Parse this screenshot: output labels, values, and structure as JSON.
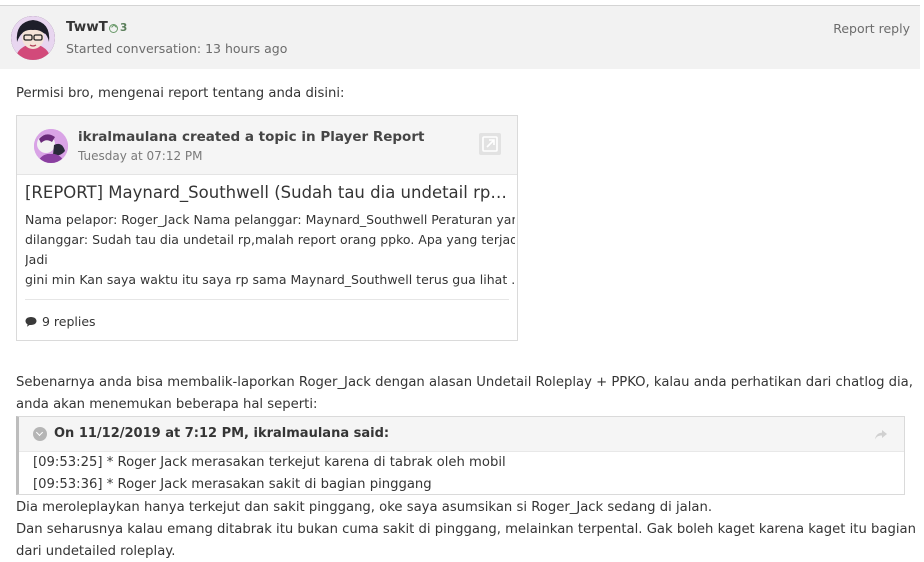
{
  "post": {
    "author": "TwwT",
    "reputation": "3",
    "meta": "Started conversation: 13 hours ago",
    "report_label": "Report reply"
  },
  "body": {
    "intro": "Permisi bro, mengenai report tentang anda disini:",
    "para1_line1": "Sebenarnya anda bisa membalik-laporkan Roger_Jack dengan alasan Undetail Roleplay + PPKO, kalau anda perhatikan dari chatlog dia,",
    "para1_line2": "anda akan menemukan beberapa hal seperti:",
    "after1": "Dia meroleplaykan hanya terkejut dan sakit pinggang, oke saya asumsikan si Roger_Jack sedang di jalan.",
    "after2": "Dan seharusnya kalau emang ditabrak itu bukan cuma sakit di pinggang, melainkan terpental. Gak boleh kaget karena kaget itu bagian",
    "after3": "dari undetailed roleplay."
  },
  "embed": {
    "author_line": "ikralmaulana created a topic in Player Report",
    "date": "Tuesday at 07:12 PM",
    "title": "[REPORT] Maynard_Southwell (Sudah tau dia undetail rp,malah report orang ppko)",
    "body_lines": [
      "Nama pelapor: Roger_Jack Nama pelanggar: Maynard_Southwell Peraturan yang",
      "dilanggar: Sudah tau dia undetail rp,malah report orang ppko. Apa yang terjadi:",
      "Jadi",
      "gini min Kan saya waktu itu saya rp sama Maynard_Southwell terus gua lihat ..."
    ],
    "replies": "9 replies"
  },
  "quote": {
    "citation": "On 11/12/2019 at 7:12 PM, ikralmaulana said:",
    "lines": [
      "[09:53:25] * Roger Jack merasakan terkejut karena di tabrak oleh mobil",
      "[09:53:36] * Roger Jack merasakan sakit di bagian pinggang"
    ]
  },
  "icons": {
    "reputation": "plus-circle-icon",
    "open_embed": "external-link-icon",
    "replies": "comment-icon",
    "quote_toggle": "chevron-down-icon",
    "quote_share": "share-arrow-icon"
  },
  "colors": {
    "header_bg": "#f2f2f2",
    "reputation_green": "#5b7f5b",
    "text": "#353535",
    "meta_text": "#6c6c6c"
  }
}
